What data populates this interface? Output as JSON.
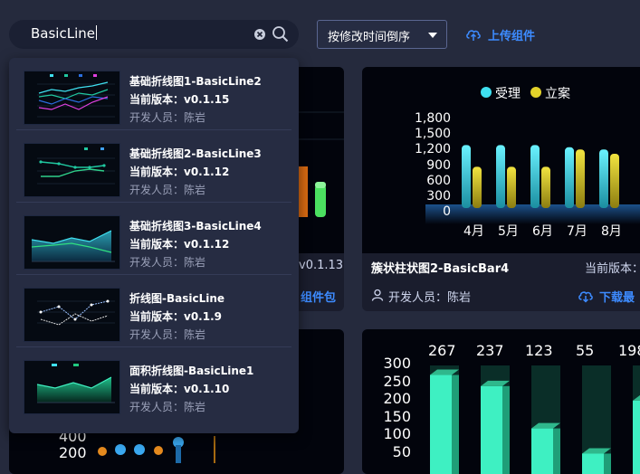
{
  "search": {
    "value": "BasicLine"
  },
  "sort": {
    "label": "按修改时间倒序"
  },
  "upload": {
    "label": "上传组件"
  },
  "cards": {
    "bar2": {
      "title": "簇状柱状图2-BasicBar4",
      "version_label": "当前版本：",
      "dev_label": "开发人员：陈岩",
      "download_label": "下载最",
      "legend": [
        "受理",
        "立案"
      ],
      "y_ticks": [
        "1,800",
        "1,500",
        "1,200",
        "900",
        "600",
        "300",
        "0"
      ],
      "x_ticks": [
        "4月",
        "5月",
        "6月",
        "7月",
        "8月"
      ]
    },
    "left": {
      "version": "v0.1.13",
      "download_label": "组件包"
    },
    "bottom_right": {
      "data_labels": [
        "267",
        "237",
        "123",
        "55",
        "198"
      ],
      "y_ticks": [
        "300",
        "250",
        "200",
        "150",
        "100",
        "50"
      ]
    },
    "bottom_left": {
      "y_ticks": [
        "400",
        "200"
      ]
    }
  },
  "results": [
    {
      "title": "基础折线图1-BasicLine2",
      "version": "当前版本：v0.1.15",
      "developer": "开发人员：陈岩"
    },
    {
      "title": "基础折线图2-BasicLine3",
      "version": "当前版本：v0.1.12",
      "developer": "开发人员：陈岩"
    },
    {
      "title": "基础折线图3-BasicLine4",
      "version": "当前版本：v0.1.12",
      "developer": "开发人员：陈岩"
    },
    {
      "title": "折线图-BasicLine",
      "version": "当前版本：v0.1.9",
      "developer": "开发人员：陈岩"
    },
    {
      "title": "面积折线图-BasicLine1",
      "version": "当前版本：v0.1.10",
      "developer": "开发人员：陈岩"
    }
  ],
  "colors": {
    "accent": "#3d8bff",
    "cyan": "#3fe0f0",
    "yellow": "#e3d22a",
    "green": "#3ef0c2"
  }
}
